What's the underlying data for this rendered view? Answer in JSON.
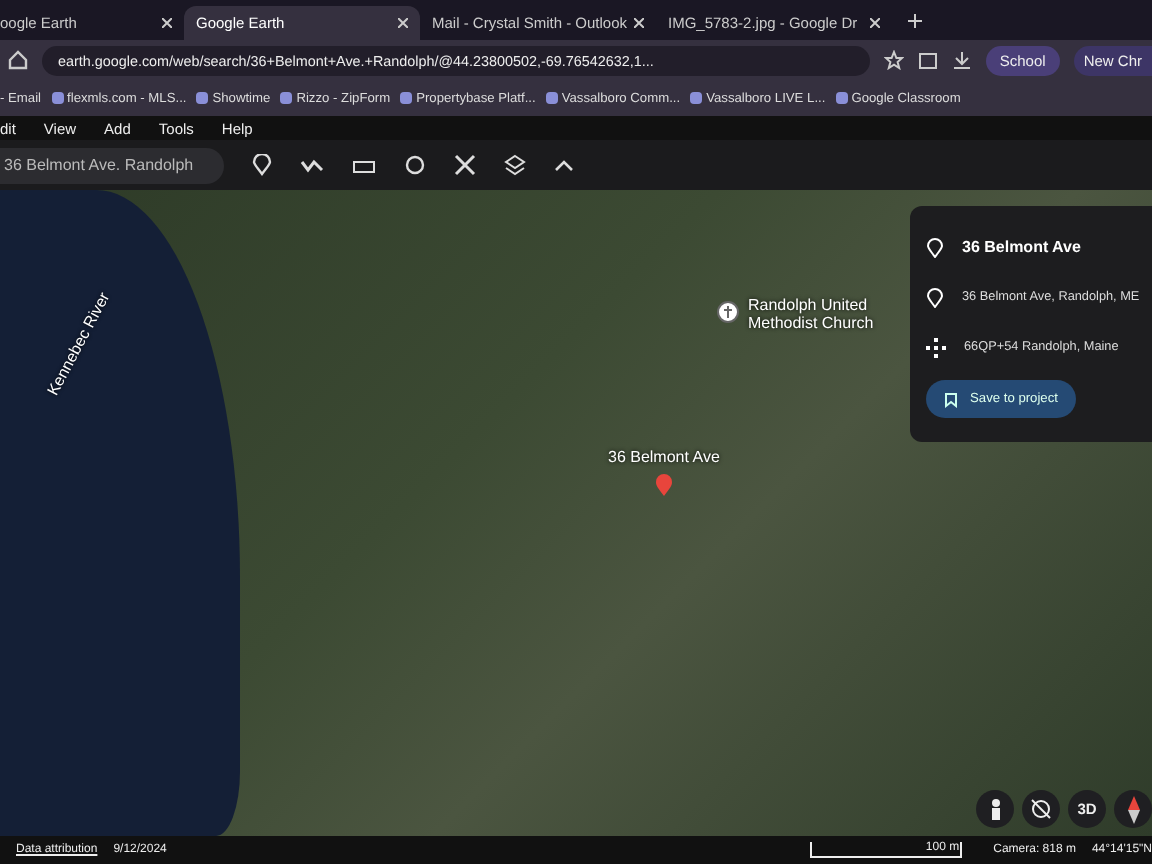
{
  "tabs": [
    {
      "title": "oogle Earth",
      "selected": false
    },
    {
      "title": "Google Earth",
      "selected": true
    },
    {
      "title": "Mail - Crystal Smith - Outlook",
      "selected": false
    },
    {
      "title": "IMG_5783-2.jpg - Google Dr",
      "selected": false
    }
  ],
  "address_bar": {
    "url": "earth.google.com/web/search/36+Belmont+Ave.+Randolph/@44.23800502,-69.76542632,1...",
    "profile": "School",
    "new_chrome": "New Chr"
  },
  "bookmarks": [
    "- Email",
    "flexmls.com - MLS...",
    "Showtime",
    "Rizzo - ZipForm",
    "Propertybase Platf...",
    "Vassalboro Comm...",
    "Vassalboro LIVE L...",
    "Google Classroom"
  ],
  "menu": [
    "dit",
    "View",
    "Add",
    "Tools",
    "Help"
  ],
  "search": {
    "value": "36 Belmont Ave. Randolph"
  },
  "map": {
    "river_label": "Kennebec River",
    "place_label": "Randolph United Methodist Church",
    "pin_label": "36 Belmont Ave"
  },
  "panel": {
    "title": "36 Belmont Ave",
    "address": "36 Belmont Ave, Randolph, ME",
    "plus_code": "66QP+54 Randolph, Maine",
    "button": "Save to project"
  },
  "map_controls": {
    "three_d": "3D"
  },
  "status_bar": {
    "attribution": "Data attribution",
    "date": "9/12/2024",
    "scale": "100 m",
    "camera": "Camera: 818 m",
    "coords": "44°14'15\"N"
  }
}
